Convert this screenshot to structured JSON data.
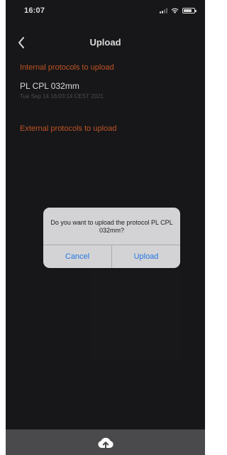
{
  "status_bar": {
    "time": "16:07"
  },
  "nav": {
    "title": "Upload",
    "back_icon": "chevron-left-icon"
  },
  "sections": {
    "internal": {
      "header": "Internal protocols to upload",
      "items": [
        {
          "name": "PL CPL 032mm",
          "date": "Tue Sep 14 16:03:14 CEST 2021"
        }
      ]
    },
    "external": {
      "header": "External protocols to upload"
    }
  },
  "alert": {
    "message": "Do you want to upload the protocol PL CPL 032mm?",
    "cancel_label": "Cancel",
    "confirm_label": "Upload"
  },
  "toolbar": {
    "upload_icon": "cloud-upload-icon"
  },
  "colors": {
    "background": "#1c1c1e",
    "section_header": "#e0612a",
    "alert_background": "#d3d3d5",
    "alert_button": "#2477e6",
    "toolbar": "#4a4a4c"
  }
}
